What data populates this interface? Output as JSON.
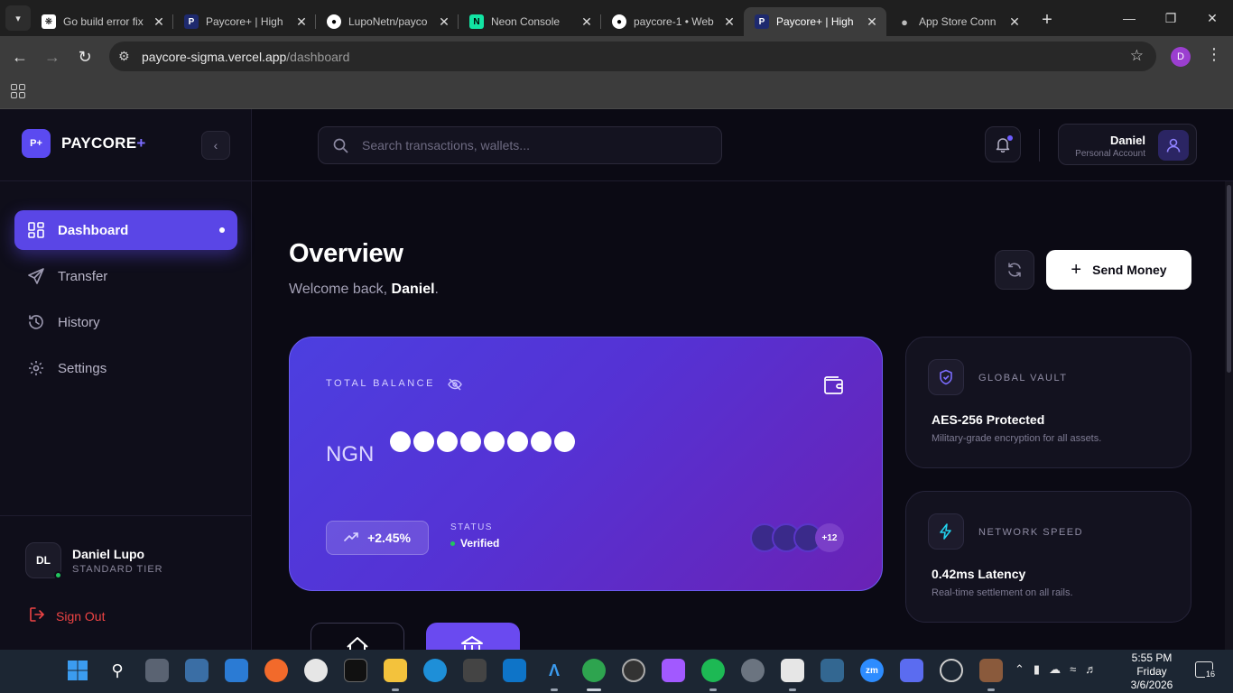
{
  "browser": {
    "tabs": [
      {
        "title": "Go build error fix",
        "icon": "openai-icon",
        "active": false
      },
      {
        "title": "Paycore+ | High",
        "icon": "paycore-icon",
        "active": false
      },
      {
        "title": "LupoNetn/payco",
        "icon": "github-icon",
        "active": false
      },
      {
        "title": "Neon Console",
        "icon": "neon-icon",
        "active": false
      },
      {
        "title": "paycore-1 • Web",
        "icon": "render-icon",
        "active": false
      },
      {
        "title": "Paycore+ | High",
        "icon": "paycore-icon",
        "active": true
      },
      {
        "title": "App Store Conn",
        "icon": "apple-icon",
        "active": false
      }
    ],
    "url_host": "paycore-sigma.vercel.app",
    "url_path": "/dashboard",
    "profile_initial": "D"
  },
  "sidebar": {
    "brand_logo": "P+",
    "brand_name": "PAYCORE",
    "brand_plus": "+",
    "items": [
      {
        "label": "Dashboard",
        "icon": "dashboard-icon",
        "active": true
      },
      {
        "label": "Transfer",
        "icon": "send-icon",
        "active": false
      },
      {
        "label": "History",
        "icon": "history-icon",
        "active": false
      },
      {
        "label": "Settings",
        "icon": "gear-icon",
        "active": false
      }
    ],
    "user": {
      "initials": "DL",
      "name": "Daniel Lupo",
      "tier": "STANDARD TIER"
    },
    "signout_label": "Sign Out"
  },
  "topbar": {
    "search_placeholder": "Search transactions, wallets...",
    "account_name": "Daniel",
    "account_type": "Personal Account"
  },
  "main": {
    "title": "Overview",
    "welcome_prefix": "Welcome back, ",
    "welcome_name": "Daniel",
    "welcome_suffix": ".",
    "send_label": "Send Money",
    "balance": {
      "label": "TOTAL BALANCE",
      "currency": "NGN",
      "masked_digits": 8,
      "trend": "+2.45%",
      "status_label": "STATUS",
      "status_value": "Verified",
      "avatars_more": "+12"
    },
    "cards": [
      {
        "label": "GLOBAL VAULT",
        "title": "AES-256 Protected",
        "desc": "Military-grade encryption for all assets.",
        "icon": "shield-icon"
      },
      {
        "label": "NETWORK SPEED",
        "title": "0.42ms Latency",
        "desc": "Real-time settlement on all rails.",
        "icon": "lightning-icon"
      }
    ]
  },
  "taskbar": {
    "time": "5:55 PM",
    "day": "Friday",
    "date": "3/6/2026",
    "notifications": "16"
  },
  "colors": {
    "accent": "#5a46e6",
    "card_gradient_start": "#4c3fe0",
    "card_gradient_end": "#6a22b5",
    "signout": "#ef4444",
    "online": "#22c55e"
  }
}
